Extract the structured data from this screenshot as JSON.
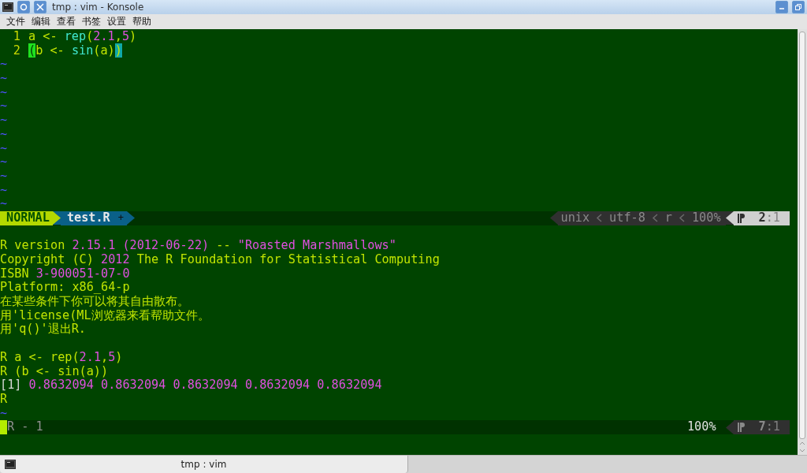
{
  "window": {
    "title": "tmp : vim - Konsole"
  },
  "menu": [
    "文件",
    "编辑",
    "查看",
    "书签",
    "设置",
    "帮助"
  ],
  "editor": {
    "lines": [
      {
        "number": "1",
        "segments": [
          {
            "text": "a <- ",
            "kind": "plain"
          },
          {
            "text": "rep",
            "kind": "func"
          },
          {
            "text": "(",
            "kind": "plain"
          },
          {
            "text": "2.1",
            "kind": "num"
          },
          {
            "text": ",",
            "kind": "plain"
          },
          {
            "text": "5",
            "kind": "num"
          },
          {
            "text": ")",
            "kind": "plain"
          }
        ]
      },
      {
        "number": "2",
        "segments": [
          {
            "text": "(",
            "kind": "match_open"
          },
          {
            "text": "b <- ",
            "kind": "plain"
          },
          {
            "text": "sin",
            "kind": "func"
          },
          {
            "text": "(a)",
            "kind": "plain"
          },
          {
            "text": ")",
            "kind": "match_close"
          }
        ]
      }
    ],
    "tildes": [
      "~",
      "~",
      "~",
      "~",
      "~",
      "~",
      "~",
      "~",
      "~",
      "~",
      "~"
    ]
  },
  "top_status": {
    "mode": "NORMAL",
    "file": "test.R",
    "modified": "+",
    "info": [
      "unix",
      "utf-8",
      "r",
      "100%"
    ],
    "line": "2",
    "col": ":1"
  },
  "console": {
    "blocks": [
      {
        "lines": [
          {
            "segments": [
              {
                "text": "R version ",
                "kind": "plain"
              },
              {
                "text": "2.15.1 (2012-06-22)",
                "kind": "num"
              },
              {
                "text": " -- ",
                "kind": "plain"
              },
              {
                "text": "\"Roasted Marshmallows\"",
                "kind": "num"
              }
            ]
          },
          {
            "segments": [
              {
                "text": "Copyright (C) ",
                "kind": "plain"
              },
              {
                "text": "2012",
                "kind": "num"
              },
              {
                "text": " The R Foundation for Statistical Computing",
                "kind": "plain"
              }
            ]
          },
          {
            "segments": [
              {
                "text": "ISBN ",
                "kind": "plain"
              },
              {
                "text": "3-900051-07-0",
                "kind": "num"
              }
            ]
          },
          {
            "segments": [
              {
                "text": "Platform: x86_64-p",
                "kind": "plain"
              }
            ]
          },
          {
            "segments": [
              {
                "text": "在某些条件下你可以将其自由散布。",
                "kind": "plain"
              }
            ]
          },
          {
            "segments": [
              {
                "text": "用'license(ML浏览器来看帮助文件。",
                "kind": "plain"
              }
            ]
          },
          {
            "segments": [
              {
                "text": "用'q()'退出R.",
                "kind": "plain"
              }
            ]
          }
        ]
      },
      {
        "lines": [
          {
            "segments": [
              {
                "text": "R a <- rep(",
                "kind": "plain"
              },
              {
                "text": "2.1",
                "kind": "num"
              },
              {
                "text": ",",
                "kind": "plain"
              },
              {
                "text": "5",
                "kind": "num"
              },
              {
                "text": ")",
                "kind": "plain"
              }
            ]
          },
          {
            "segments": [
              {
                "text": "R (b <- sin(a))",
                "kind": "plain"
              }
            ]
          },
          {
            "segments": [
              {
                "text": "[1]",
                "kind": "index"
              },
              {
                "text": " 0.8632094 0.8632094 0.8632094 0.8632094 0.8632094",
                "kind": "num"
              }
            ]
          },
          {
            "segments": [
              {
                "text": "R",
                "kind": "plain"
              }
            ]
          },
          {
            "segments": [
              {
                "text": "~",
                "kind": "tilde"
              }
            ]
          }
        ]
      }
    ]
  },
  "bottom_status": {
    "name": "R - 1",
    "percent": "100%",
    "line": "7",
    "col": ":1"
  },
  "taskbar": {
    "tabs": [
      {
        "label": "tmp : vim",
        "selected": true
      }
    ]
  }
}
